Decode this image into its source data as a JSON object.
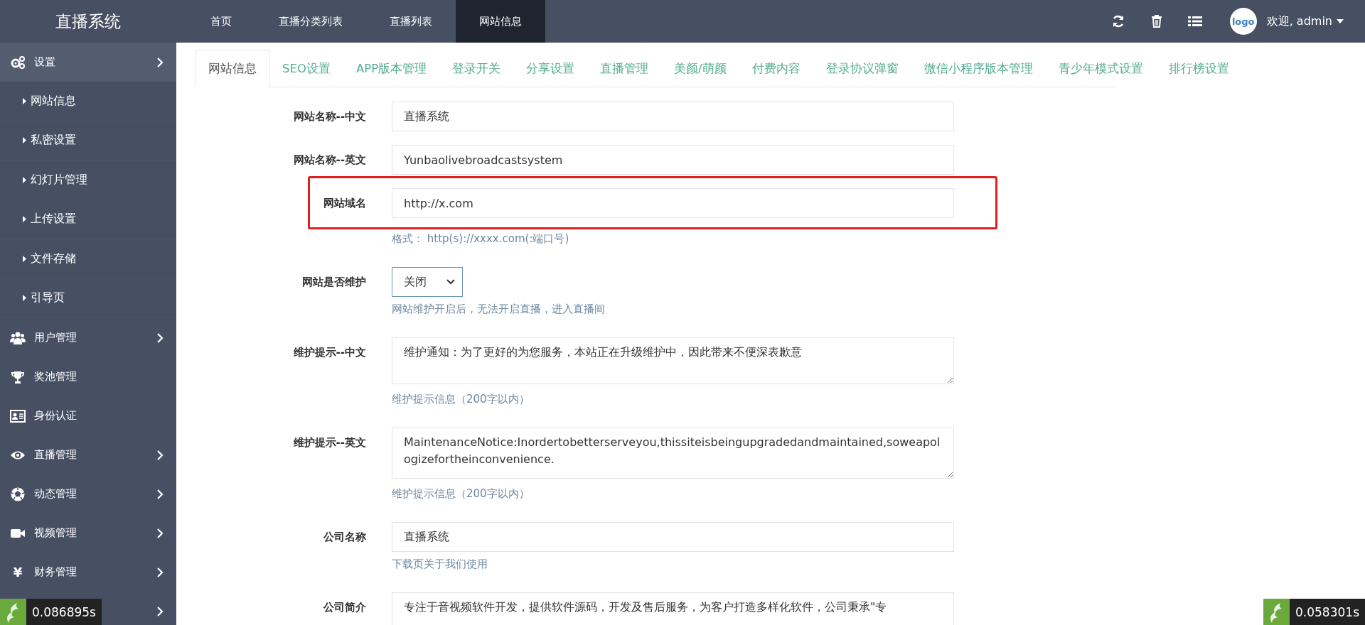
{
  "app_title": "直播系统",
  "top_nav": [
    {
      "label": "首页",
      "selected": false
    },
    {
      "label": "直播分类列表",
      "selected": false
    },
    {
      "label": "直播列表",
      "selected": false
    },
    {
      "label": "网站信息",
      "selected": true
    }
  ],
  "user": {
    "avatar_text": "logo",
    "greeting": "欢迎, admin"
  },
  "sidebar": {
    "items": [
      {
        "label": "设置",
        "selected": true,
        "expandable": true,
        "children": [
          {
            "label": "网站信息"
          },
          {
            "label": "私密设置"
          },
          {
            "label": "幻灯片管理"
          },
          {
            "label": "上传设置"
          },
          {
            "label": "文件存储"
          },
          {
            "label": "引导页"
          }
        ]
      },
      {
        "label": "用户管理",
        "selected": false,
        "expandable": true
      },
      {
        "label": "奖池管理",
        "selected": false,
        "expandable": false
      },
      {
        "label": "身份认证",
        "selected": false,
        "expandable": false
      },
      {
        "label": "直播管理",
        "selected": false,
        "expandable": true
      },
      {
        "label": "动态管理",
        "selected": false,
        "expandable": true
      },
      {
        "label": "视频管理",
        "selected": false,
        "expandable": true
      },
      {
        "label": "财务管理",
        "selected": false,
        "expandable": true,
        "icon_char": "¥"
      },
      {
        "selected": false,
        "expandable": true
      }
    ]
  },
  "tabs": [
    {
      "label": "网站信息",
      "selected": true
    },
    {
      "label": "SEO设置",
      "selected": false
    },
    {
      "label": "APP版本管理",
      "selected": false
    },
    {
      "label": "登录开关",
      "selected": false
    },
    {
      "label": "分享设置",
      "selected": false
    },
    {
      "label": "直播管理",
      "selected": false
    },
    {
      "label": "美颜/萌颜",
      "selected": false
    },
    {
      "label": "付费内容",
      "selected": false
    },
    {
      "label": "登录协议弹窗",
      "selected": false
    },
    {
      "label": "微信小程序版本管理",
      "selected": false
    },
    {
      "label": "青少年模式设置",
      "selected": false
    },
    {
      "label": "排行榜设置",
      "selected": false
    }
  ],
  "form": [
    {
      "kind": "input",
      "label": "网站名称--中文",
      "value": "直播系统",
      "highlighted": false
    },
    {
      "kind": "input",
      "label": "网站名称--英文",
      "value": "Yunbaolivebroadcastsystem",
      "highlighted": false
    },
    {
      "kind": "input",
      "label": "网站域名",
      "value": "http://x.com",
      "hint": "格式： http(s)://xxxx.com(:端口号)",
      "highlighted": true
    },
    {
      "kind": "select",
      "label": "网站是否维护",
      "value": "关闭",
      "hint": "网站维护开启后，无法开启直播，进入直播间",
      "highlighted": false
    },
    {
      "kind": "textarea",
      "label": "维护提示--中文",
      "value": "维护通知：为了更好的为您服务，本站正在升级维护中，因此带来不便深表歉意",
      "hint": "维护提示信息（200字以内）",
      "highlighted": false
    },
    {
      "kind": "textarea",
      "label": "维护提示--英文",
      "value": "MaintenanceNotice:Inordertobetterserveyou,thissiteisbeingupgradedandmaintained,soweapologizefortheinconvenience.",
      "hint": "维护提示信息（200字以内）",
      "highlighted": false
    },
    {
      "kind": "input",
      "label": "公司名称",
      "value": "直播系统",
      "hint": "下载页关于我们使用",
      "highlighted": false
    },
    {
      "kind": "textarea",
      "label": "公司简介",
      "value": "专注于音视频软件开发，提供软件源码，开发及售后服务，为客户打造多样化软件，公司秉承\"专",
      "highlighted": false
    }
  ],
  "debug_badges": [
    {
      "time": "0.086895s"
    },
    {
      "time": "0.058301s"
    }
  ]
}
